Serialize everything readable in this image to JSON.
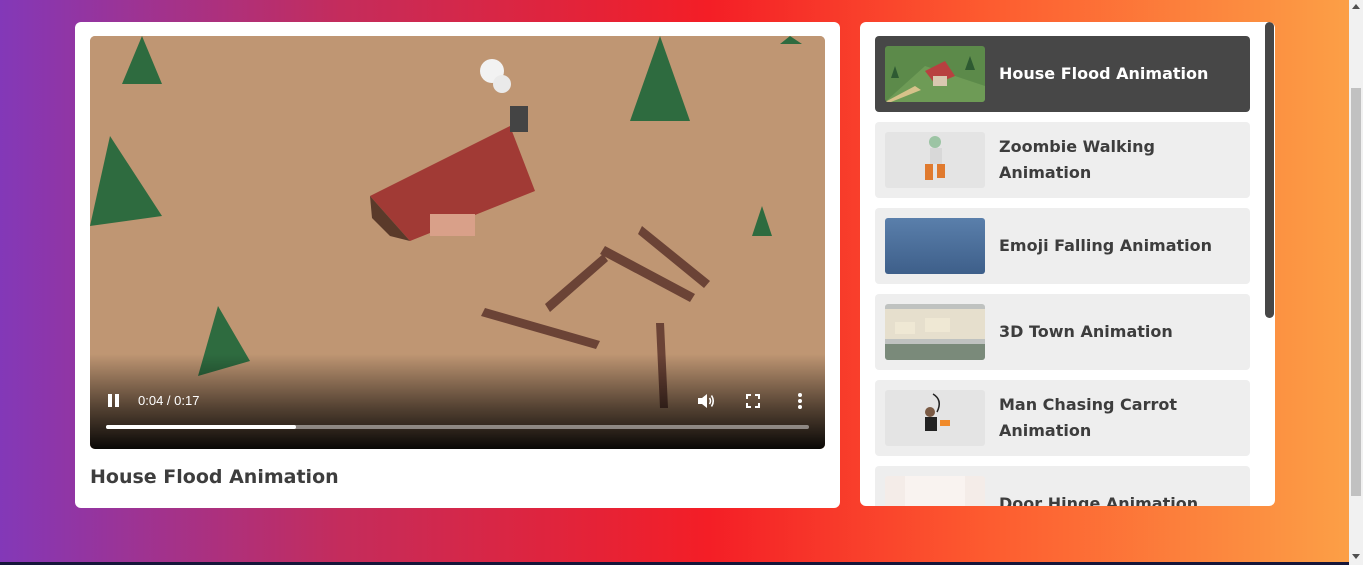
{
  "player": {
    "title": "House Flood Animation",
    "time_display": "0:04 / 0:17",
    "progress_fraction": 0.27,
    "controls": {
      "pause_icon": "pause-icon",
      "volume_icon": "volume-icon",
      "fullscreen_icon": "fullscreen-icon",
      "more_icon": "more-vertical-icon"
    }
  },
  "playlist": {
    "items": [
      {
        "label": "House Flood Animation",
        "active": true
      },
      {
        "label": "Zoombie Walking Animation",
        "active": false
      },
      {
        "label": "Emoji Falling Animation",
        "active": false
      },
      {
        "label": "3D Town Animation",
        "active": false
      },
      {
        "label": "Man Chasing Carrot Animation",
        "active": false
      },
      {
        "label": "Door Hinge Animation",
        "active": false
      }
    ]
  },
  "colors": {
    "active_item_bg": "#474747",
    "item_bg": "#eeeeee",
    "title_text": "#3d3d3d"
  }
}
